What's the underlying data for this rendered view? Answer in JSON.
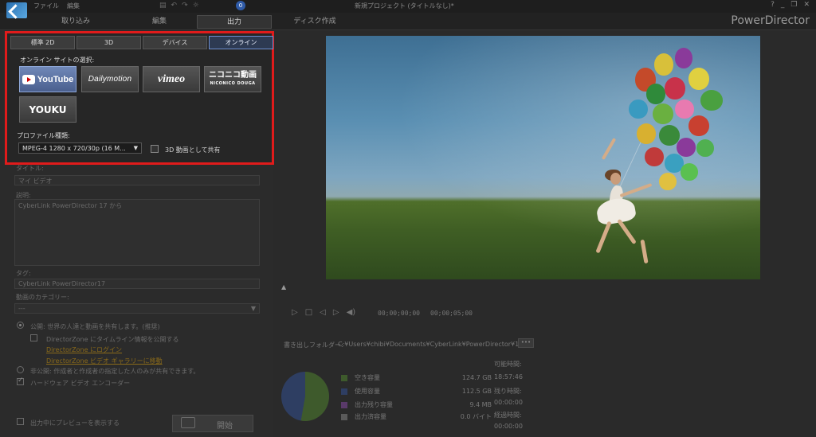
{
  "menubar": {
    "items": [
      "ファイル",
      "編集"
    ],
    "undo": "↶",
    "redo": "↷",
    "notification_count": "0",
    "window_title": "新規プロジェクト (タイトルなし)*",
    "controls": [
      "?",
      "_",
      "❐",
      "✕"
    ]
  },
  "mode_tabs": [
    "取り込み",
    "編集",
    "出力",
    "ディスク作成"
  ],
  "brand": "PowerDirector",
  "output_tabs": [
    "標準 2D",
    "3D",
    "デバイス",
    "オンライン"
  ],
  "online": {
    "site_label": "オンライン サイトの選択:",
    "sites": [
      "YouTube",
      "Dailymotion",
      "vimeo",
      "ニコニコ動画",
      "NICONICO DOUGA",
      "YOUKU"
    ]
  },
  "profile": {
    "label": "プロファイル種類:",
    "value": "MPEG-4 1280 x 720/30p (16 M...",
    "share_3d_label": "3D 動画として共有"
  },
  "form": {
    "title_label": "タイトル:",
    "title_value": "マイ ビデオ",
    "desc_label": "説明:",
    "desc_value": "CyberLink PowerDirector 17 から",
    "tags_label": "タグ:",
    "tags_value": "CyberLink PowerDirector17",
    "category_label": "動画のカテゴリー:",
    "category_value": "---",
    "public_label": "公開: 世界の人達と動画を共有します。(推奨)",
    "directorzone_label": "DirectorZone にタイムライン情報を公開する",
    "login_link": "DirectorZone にログイン",
    "gallery_link": "DirectorZone ビデオ ギャラリーに移動",
    "private_label": "非公開: 作成者と作成者の指定した人のみが共有できます。",
    "hardware_label": "ハードウェア ビデオ エンコーダー",
    "preview_label": "出力中にプレビューを表示する",
    "start_label": "開始"
  },
  "playback": {
    "timecode_current": "00;00;00;00",
    "timecode_total": "00;00;05;00"
  },
  "output": {
    "folder_label": "書き出しフォルダー:",
    "folder_path": "C:¥Users¥chibi¥Documents¥CyberLink¥PowerDirector¥1",
    "browse_label": "•••",
    "disk": [
      {
        "name": "空き容量",
        "value": "124.7  GB",
        "color": "#3e5a2c"
      },
      {
        "name": "使用容量",
        "value": "112.5  GB",
        "color": "#2e3e62"
      },
      {
        "name": "出力残り容量",
        "value": "9.4  MB",
        "color": "#5a3a6a"
      },
      {
        "name": "出力済容量",
        "value": "0.0  バイト",
        "color": "#5a5a5a"
      }
    ],
    "times": [
      {
        "label": "可能時間:",
        "value": "18:57:46"
      },
      {
        "label": "残り時間:",
        "value": "00:00:00"
      },
      {
        "label": "経過時間:",
        "value": "00:00:00"
      }
    ]
  }
}
